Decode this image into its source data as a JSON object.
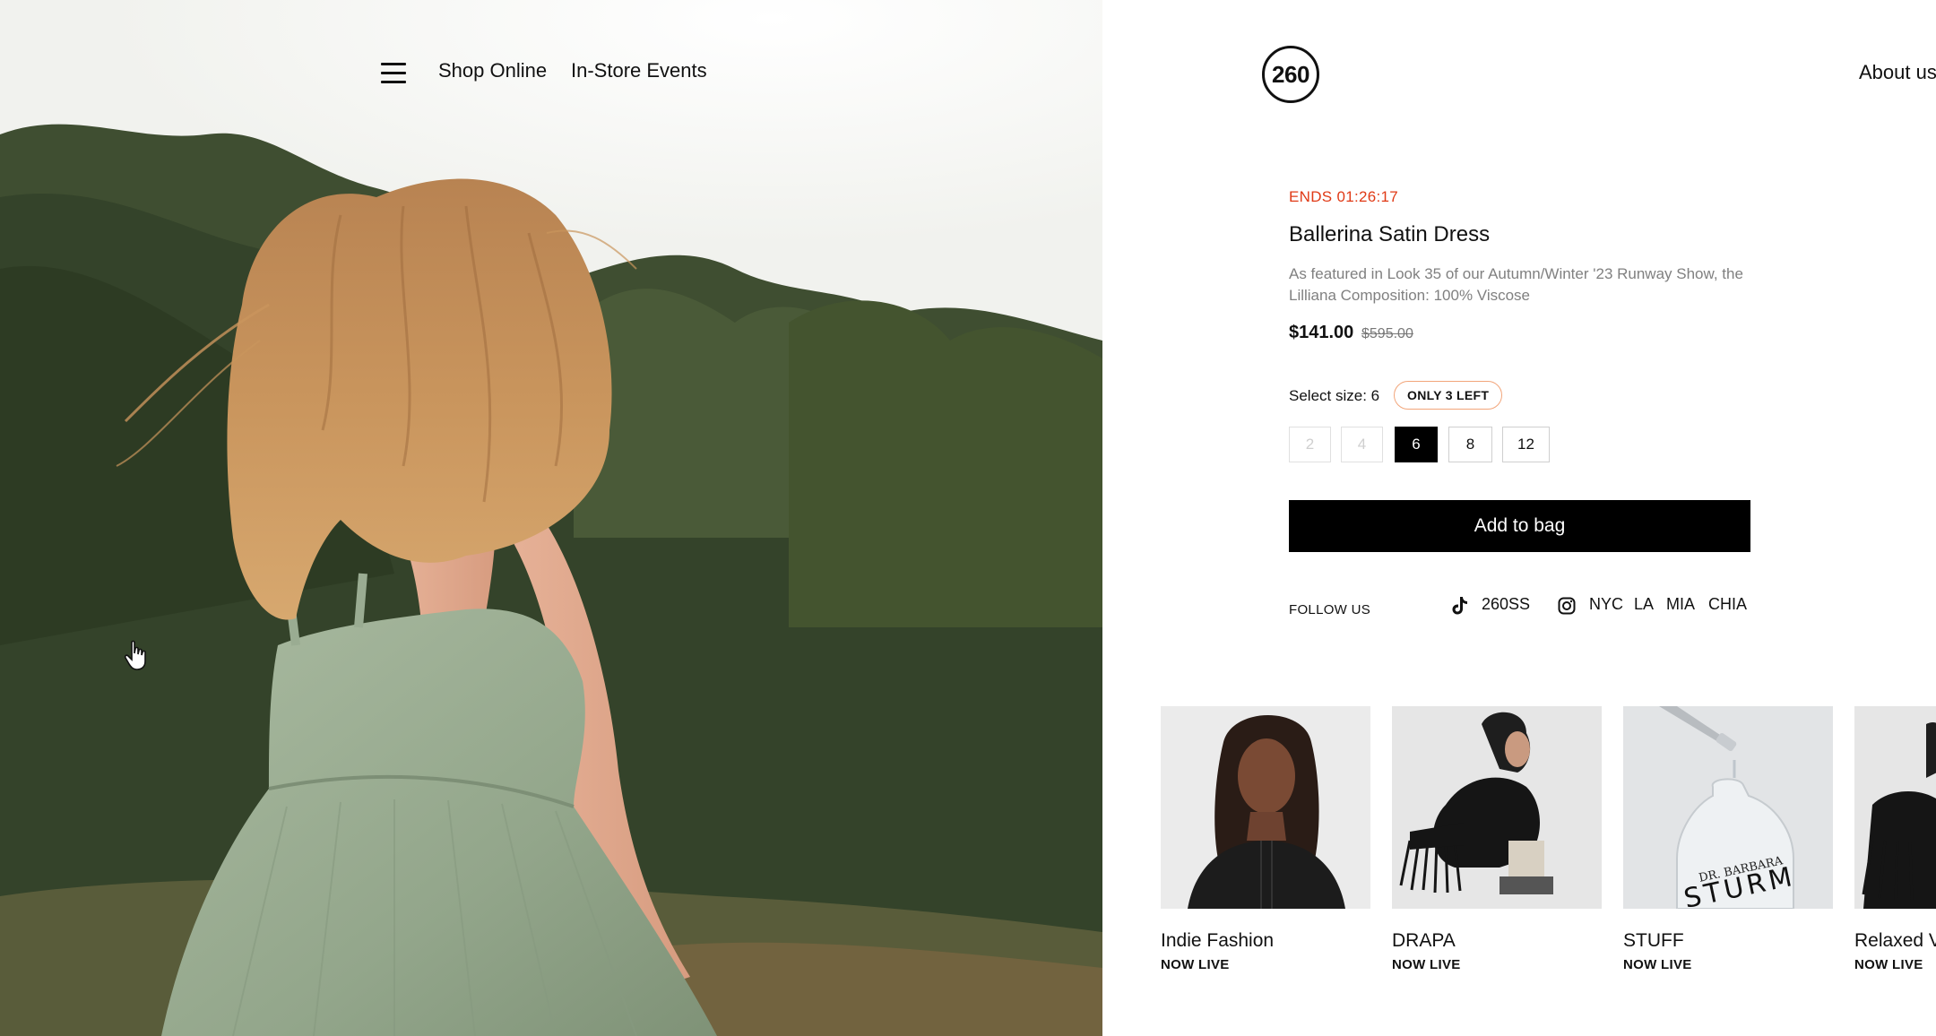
{
  "header": {
    "menu_icon": "hamburger-menu-icon",
    "nav": [
      "Shop Online",
      "In-Store Events"
    ],
    "logo": "260",
    "about": "About us"
  },
  "product": {
    "timer": "ENDS 01:26:17",
    "title": "Ballerina Satin Dress",
    "description": "As featured in Look 35 of our Autumn/Winter '23 Runway Show, the Lilliana Composition: 100% Viscose",
    "price": "$141.00",
    "original_price": "$595.00",
    "size_label": "Select size: 6",
    "stock_badge": "ONLY 3 LEFT",
    "sizes": [
      {
        "label": "2",
        "state": "disabled"
      },
      {
        "label": "4",
        "state": "disabled"
      },
      {
        "label": "6",
        "state": "selected"
      },
      {
        "label": "8",
        "state": "available"
      },
      {
        "label": "12",
        "state": "available"
      }
    ],
    "add_to_bag": "Add to bag"
  },
  "follow": {
    "label": "FOLLOW US",
    "tiktok_icon": "tiktok-icon",
    "tiktok_handle": "260SS",
    "instagram_icon": "instagram-icon",
    "cities": [
      "NYC",
      "LA",
      "MIA",
      "CHIA"
    ]
  },
  "cards": [
    {
      "name": "Indie Fashion",
      "status": "NOW LIVE"
    },
    {
      "name": "DRAPA",
      "status": "NOW LIVE"
    },
    {
      "name": "STUFF",
      "status": "NOW LIVE"
    },
    {
      "name": "Relaxed V",
      "status": "NOW LIVE"
    }
  ],
  "colors": {
    "accent": "#e03a16",
    "badge_border": "#f2a57a",
    "button": "#000000"
  }
}
